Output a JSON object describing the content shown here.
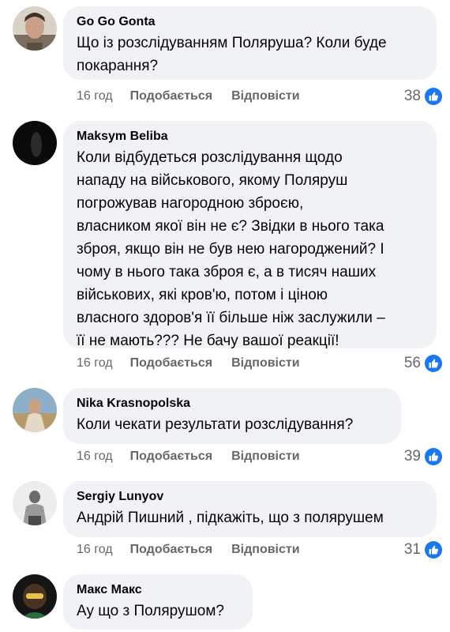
{
  "comments": [
    {
      "author": "Go Go Gonta",
      "lines": [
        "Що із розслідуванням Поляруша? Коли буде",
        "покарання?"
      ],
      "time": "16 год",
      "like_label": "Подобається",
      "reply_label": "Відповісти",
      "likes": "38"
    },
    {
      "author": "Maksym Beliba",
      "lines": [
        "Коли відбудеться розслідування щодо",
        "нападу на військового, якому Поляруш",
        "погрожував нагородною зброєю,",
        "власником якої він не є? Звідки в нього така",
        "зброя, якщо він не був нею нагороджений? І",
        "чому в нього така зброя є, а в тисяч наших",
        "військових, які кров'ю, потом і ціною",
        "власного здоров'я її більше ніж заслужили –",
        "її не мають??? Не бачу вашої реакції!"
      ],
      "time": "16 год",
      "like_label": "Подобається",
      "reply_label": "Відповісти",
      "likes": "56"
    },
    {
      "author": "Nika Krasnopolska",
      "lines": [
        "Коли чекати результати розслідування?"
      ],
      "time": "16 год",
      "like_label": "Подобається",
      "reply_label": "Відповісти",
      "likes": "39"
    },
    {
      "author": "Sergiy Lunyov",
      "lines": [
        "Андрій Пишний , підкажіть, що з полярушем"
      ],
      "time": "16 год",
      "like_label": "Подобається",
      "reply_label": "Відповісти",
      "likes": "31"
    },
    {
      "author": "Макс Макс",
      "lines": [
        "Ау що з Полярушом?"
      ]
    }
  ],
  "colors": {
    "bubble": "#f0f2f5",
    "meta": "#65676b",
    "like_blue": "#1877f2"
  },
  "icons": {
    "reaction": "thumbs-up-icon"
  }
}
